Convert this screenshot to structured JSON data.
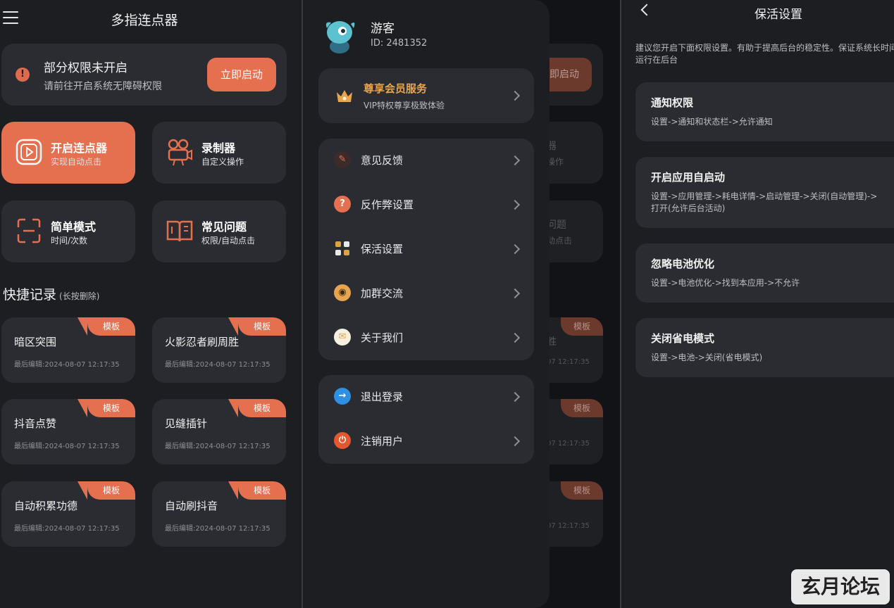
{
  "main": {
    "title": "多指连点器",
    "permission": {
      "title": "部分权限未开启",
      "subtitle": "请前往开启系统无障碍权限",
      "button": "立即启动"
    },
    "features": [
      {
        "title": "开启连点器",
        "subtitle": "实现自动点击",
        "icon": "play-square-icon"
      },
      {
        "title": "录制器",
        "subtitle": "自定义操作",
        "icon": "camera-icon"
      },
      {
        "title": "简单模式",
        "subtitle": "时间/次数",
        "icon": "scan-frame-icon"
      },
      {
        "title": "常见问题",
        "subtitle": "权限/自动点击",
        "icon": "book-icon"
      }
    ],
    "records_title": "快捷记录",
    "records_hint": "(长按删除)",
    "records": [
      {
        "title": "暗区突围",
        "time": "最后编辑:2024-08-07 12:17:35",
        "tag": "模板"
      },
      {
        "title": "火影忍者刷周胜",
        "time": "最后编辑:2024-08-07 12:17:35",
        "tag": "模板"
      },
      {
        "title": "抖音点赞",
        "time": "最后编辑:2024-08-07 12:17:35",
        "tag": "模板"
      },
      {
        "title": "见缝插针",
        "time": "最后编辑:2024-08-07 12:17:35",
        "tag": "模板"
      },
      {
        "title": "自动积累功德",
        "time": "最后编辑:2024-08-07 12:17:35",
        "tag": "模板"
      },
      {
        "title": "自动刷抖音",
        "time": "最后编辑:2024-08-07 12:17:35",
        "tag": "模板"
      }
    ]
  },
  "drawer": {
    "user": {
      "name": "游客",
      "id": "ID: 2481352"
    },
    "vip": {
      "title": "尊享会员服务",
      "subtitle": "VIP特权尊享极致体验"
    },
    "menu": [
      {
        "label": "意见反馈",
        "icon": "feedback-icon",
        "color": "#3a2a2a"
      },
      {
        "label": "反作弊设置",
        "icon": "question-icon",
        "color": "#e5704f"
      },
      {
        "label": "保活设置",
        "icon": "qr-grid-icon",
        "color": "#d9a441"
      },
      {
        "label": "加群交流",
        "icon": "chat-group-icon",
        "color": "#e8a54f"
      },
      {
        "label": "关于我们",
        "icon": "mail-icon",
        "color": "#f5f0e0"
      }
    ],
    "account": [
      {
        "label": "退出登录",
        "icon": "logout-icon",
        "color": "#2f8fe0"
      },
      {
        "label": "注销用户",
        "icon": "power-icon",
        "color": "#e5572f"
      }
    ],
    "behind": {
      "button": "即启动",
      "rec1": "胜",
      "rec_tag": "模板",
      "rec_time": "07 12:17:35",
      "feat1": "器",
      "feat1_sub": "操作",
      "feat2": "问题",
      "feat2_sub": "动点击"
    }
  },
  "settings": {
    "title": "保活设置",
    "intro": "建议您开启下面权限设置。有助于提高后台的稳定性。保证系统长时间运行在后台",
    "items": [
      {
        "title": "通知权限",
        "desc": "设置->通知和状态栏->允许通知"
      },
      {
        "title": "开启应用自启动",
        "desc": "设置->应用管理->耗电详情->启动管理->关闭(自动管理)->打开(允许后台活动)"
      },
      {
        "title": "忽略电池优化",
        "desc": "设置->电池优化->找到本应用->不允许"
      },
      {
        "title": "关闭省电模式",
        "desc": "设置->电池->关闭(省电模式)"
      }
    ]
  },
  "watermark": "玄月论坛",
  "colors": {
    "accent": "#e5704f",
    "card": "#2b2c31",
    "background": "#1d1e22",
    "vip": "#e8a54f"
  }
}
